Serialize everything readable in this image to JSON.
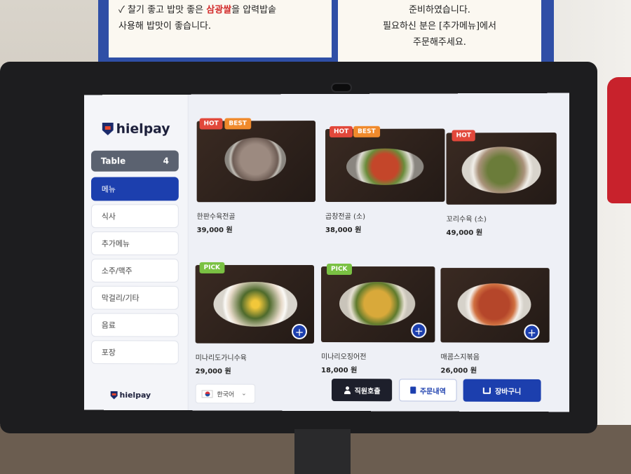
{
  "signs": {
    "left_line1": "✓ 찰기 좋고 밥맛 좋은 삼광쌀을 압력밥솥",
    "left_line2": "사용해 밥맛이 좋습니다.",
    "left_highlight": "삼광쌀",
    "right_line1": "준비하였습니다.",
    "right_line2": "필요하신 분은 [추가메뉴]에서",
    "right_line3": "주문해주세요."
  },
  "brand": {
    "name": "hielpay",
    "footer": "hielpay"
  },
  "table": {
    "label": "Table",
    "number": "4"
  },
  "sidebar": {
    "items": [
      {
        "label": "메뉴",
        "active": true
      },
      {
        "label": "식사",
        "active": false
      },
      {
        "label": "추가메뉴",
        "active": false
      },
      {
        "label": "소주/맥주",
        "active": false
      },
      {
        "label": "막걸리/기타",
        "active": false
      },
      {
        "label": "음료",
        "active": false
      },
      {
        "label": "포장",
        "active": false
      }
    ]
  },
  "menu": {
    "items": [
      {
        "name": "한판수육전골",
        "price": "39,000 원",
        "badges": [
          "HOT",
          "BEST"
        ]
      },
      {
        "name": "곱창전골 (소)",
        "price": "38,000 원",
        "badges": [
          "HOT",
          "BEST"
        ]
      },
      {
        "name": "꼬리수육 (소)",
        "price": "49,000 원",
        "badges": [
          "HOT"
        ]
      },
      {
        "name": "미나리도가니수육",
        "price": "29,000 원",
        "badges": [
          "PICK"
        ]
      },
      {
        "name": "미나리오징어전",
        "price": "18,000 원",
        "badges": [
          "PICK"
        ]
      },
      {
        "name": "매콤스지볶음",
        "price": "26,000 원",
        "badges": []
      }
    ],
    "add_symbol": "+"
  },
  "footer": {
    "language": "한국어",
    "staff_call": "직원호출",
    "order_history": "주문내역",
    "cart": "장바구니"
  },
  "colors": {
    "primary": "#1c3fae",
    "hot": "#e2483b",
    "best": "#f08a2c",
    "pick": "#7ac143",
    "dark_button": "#1d1f2b"
  }
}
